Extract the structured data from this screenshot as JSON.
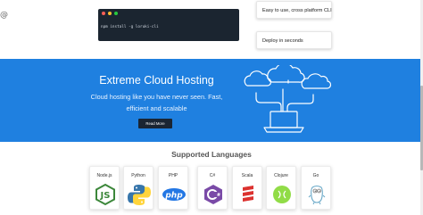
{
  "top": {
    "left_icon": "@",
    "terminal": {
      "command": "npm install -g loruki-cli",
      "dot_colors": [
        "#ff5f56",
        "#ffbd2e",
        "#27c93f"
      ]
    },
    "features": [
      "Easy to use, cross platform CLI",
      "Deploy in seconds"
    ]
  },
  "hero": {
    "title": "Extreme Cloud Hosting",
    "text": "Cloud hosting like you have never seen. Fast, efficient and scalable",
    "button": "Read More",
    "background": "#1f80e0",
    "illustration_icon": "cloud-network-laptop-icon"
  },
  "languages": {
    "title": "Supported Languages",
    "items": [
      {
        "name": "Node.js",
        "icon": "nodejs-icon",
        "color": "#3c873a"
      },
      {
        "name": "Python",
        "icon": "python-icon",
        "color": "#3776ab"
      },
      {
        "name": "PHP",
        "icon": "php-icon",
        "color": "#2377e4"
      },
      {
        "name": "C#",
        "icon": "csharp-icon",
        "color": "#7a4aa7"
      },
      {
        "name": "Scala",
        "icon": "scala-icon",
        "color": "#dc322f"
      },
      {
        "name": "Clojure",
        "icon": "clojure-icon",
        "color": "#5881d8"
      },
      {
        "name": "Go",
        "icon": "go-icon",
        "color": "#7fd5ea"
      }
    ]
  }
}
